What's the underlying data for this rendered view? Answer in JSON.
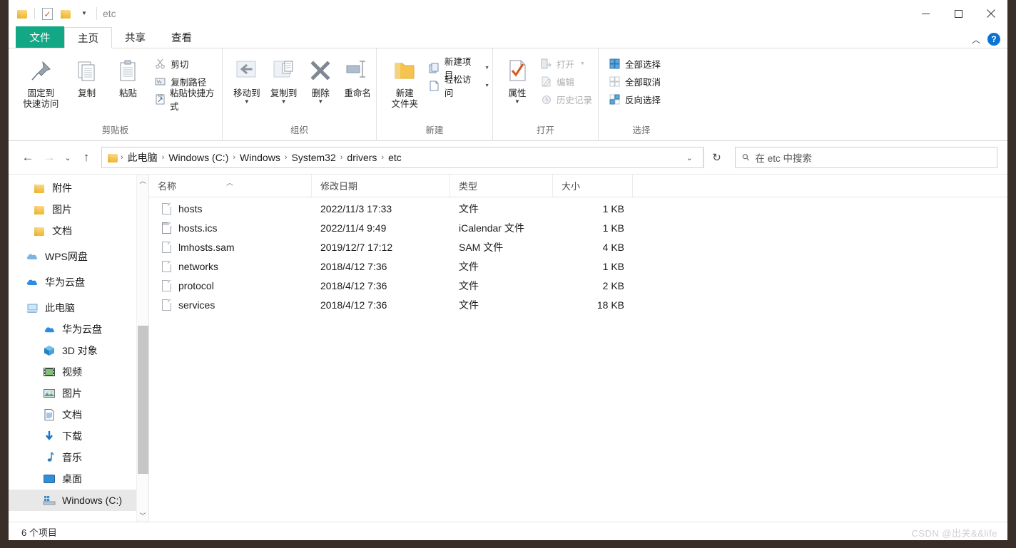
{
  "window": {
    "title": "etc",
    "controls": {
      "minimize": "minimize-icon",
      "maximize": "maximize-icon",
      "close": "close-icon"
    },
    "quick_access": [
      "folder-icon",
      "properties-icon",
      "new-folder-icon",
      "customize-caret-icon"
    ]
  },
  "tabs": [
    {
      "label": "文件",
      "name": "tab-file"
    },
    {
      "label": "主页",
      "name": "tab-home"
    },
    {
      "label": "共享",
      "name": "tab-share"
    },
    {
      "label": "查看",
      "name": "tab-view"
    }
  ],
  "tabbar_right": {
    "collapse": "chevron-up-icon",
    "help": "?"
  },
  "ribbon": {
    "groups": [
      {
        "label": "剪贴板",
        "big": [
          {
            "label": "固定到\n快速访问",
            "line1": "固定到",
            "line2": "快速访问",
            "icon": "pin-icon"
          },
          {
            "label": "复制",
            "icon": "copy-icon"
          },
          {
            "label": "粘贴",
            "icon": "paste-icon"
          }
        ],
        "small": [
          {
            "label": "剪切",
            "icon": "scissors-icon"
          },
          {
            "label": "复制路径",
            "icon": "copy-path-icon"
          },
          {
            "label": "粘贴快捷方式",
            "icon": "paste-shortcut-icon"
          }
        ]
      },
      {
        "label": "组织",
        "big": [
          {
            "label": "移动到",
            "icon": "move-to-icon",
            "caret": true
          },
          {
            "label": "复制到",
            "icon": "copy-to-icon",
            "caret": true
          },
          {
            "label": "删除",
            "icon": "delete-icon",
            "caret": true
          },
          {
            "label": "重命名",
            "icon": "rename-icon"
          }
        ],
        "small": []
      },
      {
        "label": "新建",
        "big": [
          {
            "line1": "新建",
            "line2": "文件夹",
            "icon": "new-folder-icon"
          }
        ],
        "small": [
          {
            "label": "新建项目",
            "icon": "new-item-icon",
            "caret": true
          },
          {
            "label": "轻松访问",
            "icon": "easy-access-icon",
            "caret": true
          }
        ]
      },
      {
        "label": "打开",
        "big": [
          {
            "label": "属性",
            "icon": "properties-icon",
            "caret": true
          }
        ],
        "small": [
          {
            "label": "打开",
            "icon": "open-icon",
            "caret": true,
            "disabled": true
          },
          {
            "label": "编辑",
            "icon": "edit-icon",
            "disabled": true
          },
          {
            "label": "历史记录",
            "icon": "history-icon",
            "disabled": true
          }
        ]
      },
      {
        "label": "选择",
        "big": [],
        "small": [
          {
            "label": "全部选择",
            "icon": "select-all-icon"
          },
          {
            "label": "全部取消",
            "icon": "select-none-icon"
          },
          {
            "label": "反向选择",
            "icon": "invert-selection-icon"
          }
        ]
      }
    ]
  },
  "address": {
    "back": "back-arrow-icon",
    "forward": "forward-arrow-icon",
    "recent": "chevron-down-icon",
    "up": "up-arrow-icon",
    "breadcrumbs": [
      "此电脑",
      "Windows (C:)",
      "Windows",
      "System32",
      "drivers",
      "etc"
    ],
    "separator": "›",
    "dropdown": "chevron-down-icon",
    "refresh": "refresh-icon"
  },
  "search": {
    "icon": "search-icon",
    "placeholder": "在 etc 中搜索"
  },
  "sidebar": {
    "scroll_up": "scroll-up-arrow-icon",
    "scroll_down": "scroll-down-arrow-icon",
    "items": [
      {
        "label": "附件",
        "icon": "folder-icon",
        "indent": 1,
        "selected": false
      },
      {
        "label": "图片",
        "icon": "folder-icon",
        "indent": 1,
        "selected": false
      },
      {
        "label": "文档",
        "icon": "folder-icon",
        "indent": 1,
        "selected": false
      },
      {
        "label": "WPS网盘",
        "icon": "cloud-icon",
        "indent": 0,
        "selected": false
      },
      {
        "label": "华为云盘",
        "icon": "cloud-blue-icon",
        "indent": 0,
        "selected": false
      },
      {
        "label": "此电脑",
        "icon": "this-pc-icon",
        "indent": 0,
        "selected": false
      },
      {
        "label": "华为云盘",
        "icon": "cloud-blue-icon",
        "indent": 1,
        "selected": false
      },
      {
        "label": "3D 对象",
        "icon": "3d-object-icon",
        "indent": 1,
        "selected": false
      },
      {
        "label": "视频",
        "icon": "videos-icon",
        "indent": 1,
        "selected": false
      },
      {
        "label": "图片",
        "icon": "pictures-icon",
        "indent": 1,
        "selected": false
      },
      {
        "label": "文档",
        "icon": "documents-icon",
        "indent": 1,
        "selected": false
      },
      {
        "label": "下载",
        "icon": "downloads-icon",
        "indent": 1,
        "selected": false
      },
      {
        "label": "音乐",
        "icon": "music-icon",
        "indent": 1,
        "selected": false
      },
      {
        "label": "桌面",
        "icon": "desktop-icon",
        "indent": 1,
        "selected": false
      },
      {
        "label": "Windows (C:)",
        "icon": "drive-icon",
        "indent": 1,
        "selected": true
      }
    ]
  },
  "filelist": {
    "columns": [
      {
        "label": "名称",
        "sorted": "asc"
      },
      {
        "label": "修改日期",
        "sorted": ""
      },
      {
        "label": "类型",
        "sorted": ""
      },
      {
        "label": "大小",
        "sorted": ""
      }
    ],
    "sort_indicator": "▲",
    "rows": [
      {
        "name": "hosts",
        "date": "2022/11/3 17:33",
        "type": "文件",
        "size": "1 KB",
        "icon": "file-icon"
      },
      {
        "name": "hosts.ics",
        "date": "2022/11/4 9:49",
        "type": "iCalendar 文件",
        "size": "1 KB",
        "icon": "calendar-file-icon"
      },
      {
        "name": "lmhosts.sam",
        "date": "2019/12/7 17:12",
        "type": "SAM 文件",
        "size": "4 KB",
        "icon": "file-icon"
      },
      {
        "name": "networks",
        "date": "2018/4/12 7:36",
        "type": "文件",
        "size": "1 KB",
        "icon": "file-icon"
      },
      {
        "name": "protocol",
        "date": "2018/4/12 7:36",
        "type": "文件",
        "size": "2 KB",
        "icon": "file-icon"
      },
      {
        "name": "services",
        "date": "2018/4/12 7:36",
        "type": "文件",
        "size": "18 KB",
        "icon": "file-icon"
      }
    ]
  },
  "statusbar": {
    "item_count": "6 个项目",
    "watermark": "CSDN @出关&&life"
  },
  "colors": {
    "file_tab": "#12a785",
    "help_icon": "#0a74d2",
    "selection": "#e8e8e8"
  }
}
